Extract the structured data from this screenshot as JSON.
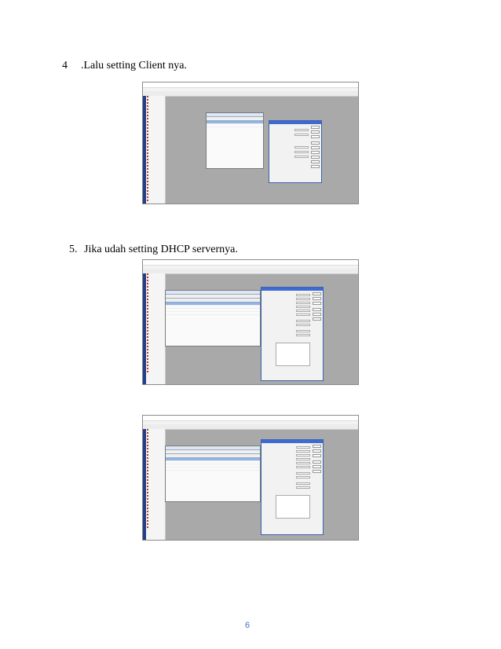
{
  "steps": [
    {
      "number": "4",
      "text": ".Lalu setting Client nya."
    },
    {
      "number": "5.",
      "text": "Jika udah setting DHCP servernya."
    }
  ],
  "page_number": "6",
  "colors": {
    "page_number": "#4472c4",
    "winbox_sidebar": "#243e8a",
    "dialog_title": "#3e6ad1",
    "selected_row": "#8fb4e6"
  }
}
